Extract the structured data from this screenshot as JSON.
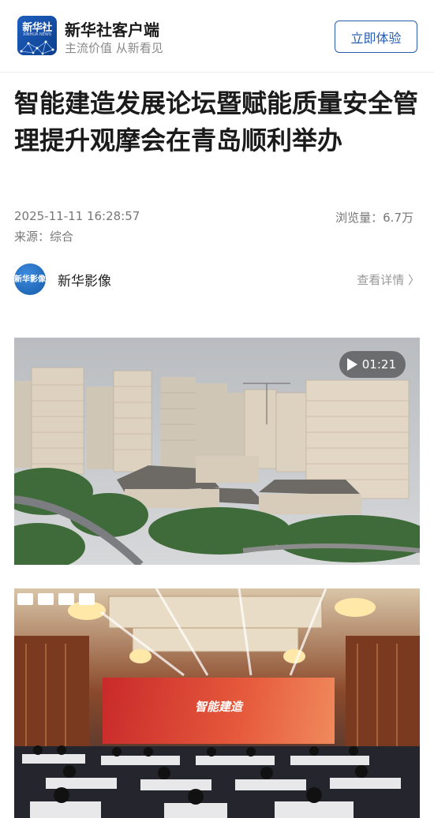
{
  "app": {
    "name": "新华社客户端",
    "slogan": "主流价值 从新看见",
    "logo_text": "新华社",
    "logo_sub": "XINHUA NEWS",
    "cta_label": "立即体验"
  },
  "article": {
    "title": "智能建造发展论坛暨赋能质量安全管理提升观摩会在青岛顺利举办",
    "datetime": "2025-11-11 16:28:57",
    "views": "浏览量：6.7万",
    "source": "来源：综合"
  },
  "author": {
    "avatar_text": "新华影像",
    "name": "新华影像",
    "more_label": "查看详情 〉"
  },
  "video": {
    "duration": "01:21"
  },
  "photo2": {
    "banner_text": "智能建造"
  },
  "icons": [
    "xinhua-logo-icon",
    "play-icon",
    "chevron-right-icon"
  ],
  "colors": {
    "brand_blue": "#2a5db0",
    "meta_gray": "#777777",
    "banner_red": "#c92a2a"
  }
}
